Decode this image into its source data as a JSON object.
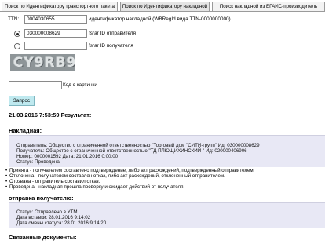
{
  "tabs": [
    {
      "label": "Поиск по Идентификатору транспортного пакета",
      "active": false
    },
    {
      "label": "Поиск по Идентификатору накладной",
      "active": true
    },
    {
      "label": "Поиск накладной из ЕГАИС-производитель",
      "active": false
    }
  ],
  "form": {
    "ttn_label": "TTN:",
    "ttn_value": "0004030655",
    "ttn_hint": "идентификатор накладной (WBRegId вида TTN-0000000000)",
    "sender_value": "030000008629",
    "sender_hint": "fsrar ID отправителя",
    "receiver_value": "",
    "receiver_hint": "fsrar ID получателя",
    "captcha_text": "CY9RB9",
    "captcha_input": "",
    "captcha_label": "Код с картинки",
    "submit_label": "Запрос"
  },
  "result": {
    "heading": "21.03.2016 7:53:59 Результат:",
    "invoice_heading": "Накладная:",
    "invoice_lines": [
      "Отправитель: Общество с ограниченной ответственностью \"Торговый дом \"СИТИ-групп\" Ид: 030000008629",
      "Получатель: Общество с ограниченной ответственностью \"ТД ПЛЮЩИХИНСКИЙ \" Ид: 020000406906",
      "Номер: 0000001592 Дата: 21.01.2016 0:00:00",
      "Статус: Проведена"
    ],
    "legend": [
      "Принята - получателем составлено подтверждение, либо акт расхождений, подтвержденный отправителем.",
      "Отклонена - получателем составлен отказ, либо акт расхождений, отклоненный отправителем.",
      "Отозвана - отправитель составил отказ.",
      "Проведена - накладная прошла проверку и ожидает действий от получателя."
    ],
    "send_heading": "отправка получателю:",
    "send_lines": [
      "Статус: Отправлено в УТМ",
      "Дата вставки: 28.01.2016 9:14:02",
      "Дата смены статуса: 28.01.2016 9:14:20"
    ],
    "linked_heading": "Связанные документы:"
  }
}
